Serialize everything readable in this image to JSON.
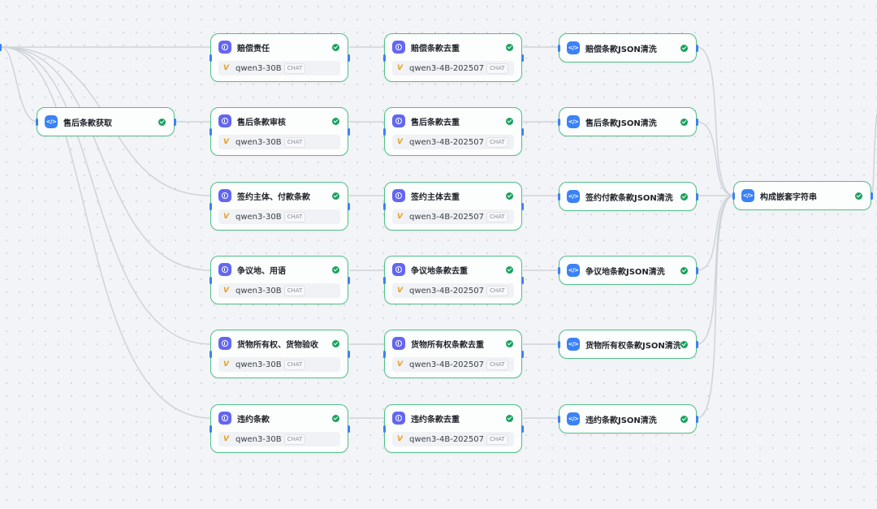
{
  "canvas": {
    "source": {
      "name": "source-node"
    },
    "after_sales": {
      "icon": "code-icon",
      "title": "售后条款获取",
      "status": "success"
    },
    "columns": {
      "extract": {
        "icon": "llm-icon",
        "model": "qwen3-30B",
        "badge": "CHAT",
        "nodes": [
          {
            "title": "赔偿责任"
          },
          {
            "title": "售后条款审核"
          },
          {
            "title": "签约主体、付款条款"
          },
          {
            "title": "争议地、用语"
          },
          {
            "title": "货物所有权、货物验收"
          },
          {
            "title": "违约条款"
          }
        ]
      },
      "dedupe": {
        "icon": "llm-icon",
        "model": "qwen3-4B-202507",
        "badge": "CHAT",
        "nodes": [
          {
            "title": "赔偿条款去重"
          },
          {
            "title": "售后条款去重"
          },
          {
            "title": "签约主体去重"
          },
          {
            "title": "争议地条款去重"
          },
          {
            "title": "货物所有权条款去重"
          },
          {
            "title": "违约条款去重"
          }
        ]
      },
      "clean": {
        "icon": "code-icon",
        "nodes": [
          {
            "title": "赔偿条款JSON清洗"
          },
          {
            "title": "售后条款JSON清洗"
          },
          {
            "title": "签约付款条款JSON清洗"
          },
          {
            "title": "争议地条款JSON清洗"
          },
          {
            "title": "货物所有权条款JSON清洗"
          },
          {
            "title": "违约条款JSON清洗"
          }
        ]
      }
    },
    "merge": {
      "icon": "code-icon",
      "title": "构成嵌套字符串",
      "status": "success"
    },
    "colors": {
      "node_border": "#4fc08a",
      "llm_icon": "#6366f1",
      "code_icon": "#3b82f6",
      "success": "#1aa260",
      "edge": "#cfd3d9",
      "port": "#3b82f6"
    }
  }
}
